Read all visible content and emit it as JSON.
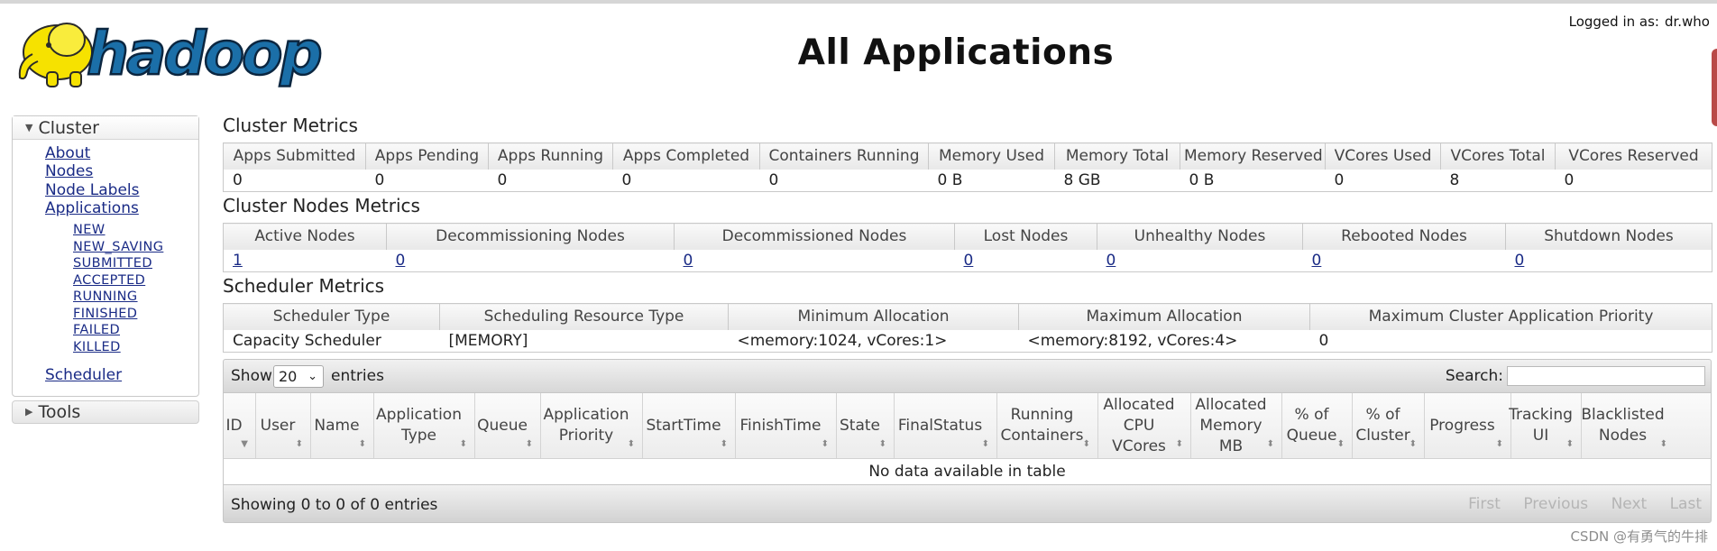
{
  "header": {
    "logo_text": "hadoop",
    "title": "All Applications",
    "login_label": "Logged in as:",
    "login_user": "dr.who"
  },
  "sidebar": {
    "cluster_label": "Cluster",
    "links": [
      "About",
      "Nodes",
      "Node Labels",
      "Applications"
    ],
    "app_states": [
      "NEW",
      "NEW_SAVING",
      "SUBMITTED",
      "ACCEPTED",
      "RUNNING",
      "FINISHED",
      "FAILED",
      "KILLED"
    ],
    "scheduler_label": "Scheduler",
    "tools_label": "Tools"
  },
  "cluster_metrics": {
    "title": "Cluster Metrics",
    "headers": [
      "Apps Submitted",
      "Apps Pending",
      "Apps Running",
      "Apps Completed",
      "Containers Running",
      "Memory Used",
      "Memory Total",
      "Memory Reserved",
      "VCores Used",
      "VCores Total",
      "VCores Reserved"
    ],
    "values": [
      "0",
      "0",
      "0",
      "0",
      "0",
      "0 B",
      "8 GB",
      "0 B",
      "0",
      "8",
      "0"
    ]
  },
  "node_metrics": {
    "title": "Cluster Nodes Metrics",
    "headers": [
      "Active Nodes",
      "Decommissioning Nodes",
      "Decommissioned Nodes",
      "Lost Nodes",
      "Unhealthy Nodes",
      "Rebooted Nodes",
      "Shutdown Nodes"
    ],
    "values": [
      "1",
      "0",
      "0",
      "0",
      "0",
      "0",
      "0"
    ]
  },
  "scheduler_metrics": {
    "title": "Scheduler Metrics",
    "headers": [
      "Scheduler Type",
      "Scheduling Resource Type",
      "Minimum Allocation",
      "Maximum Allocation",
      "Maximum Cluster Application Priority"
    ],
    "values": [
      "Capacity Scheduler",
      "[MEMORY]",
      "<memory:1024, vCores:1>",
      "<memory:8192, vCores:4>",
      "0"
    ]
  },
  "apps_table": {
    "show_label": "Show",
    "page_length": "20",
    "entries_label": "entries",
    "search_label": "Search:",
    "search_value": "",
    "columns": [
      "ID",
      "User",
      "Name",
      "Application Type",
      "Queue",
      "Application Priority",
      "StartTime",
      "FinishTime",
      "State",
      "FinalStatus",
      "Running Containers",
      "Allocated CPU VCores",
      "Allocated Memory MB",
      "% of Queue",
      "% of Cluster",
      "Progress",
      "Tracking UI",
      "Blacklisted Nodes"
    ],
    "empty_message": "No data available in table",
    "info": "Showing 0 to 0 of 0 entries",
    "pager": [
      "First",
      "Previous",
      "Next",
      "Last"
    ]
  },
  "watermark": "CSDN @有勇气的牛排",
  "colors": {
    "link": "#1a2b86",
    "logo_yellow": "#f6e200",
    "logo_blue": "#1b6fa8"
  }
}
